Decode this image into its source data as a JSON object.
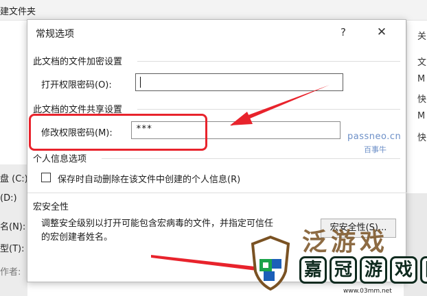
{
  "background": {
    "window_title": "建文件夹",
    "left_rows": [
      "盘 (C:)",
      "(D:)",
      "名(N):",
      "型(T):",
      "作者:"
    ],
    "right_items": [
      "关",
      "文",
      "M",
      "快",
      "M",
      "快"
    ]
  },
  "dialog": {
    "title": "常规选项",
    "help_label": "?",
    "close_label": "✕",
    "encryption": {
      "section_title": "此文档的文件加密设置",
      "open_label": "打开权限密码(O):",
      "open_value": ""
    },
    "sharing": {
      "section_title": "此文档的文件共享设置",
      "modify_label": "修改权限密码(M):",
      "modify_value": "***"
    },
    "privacy": {
      "section_title": "个人信息选项",
      "checkbox_label": "保存时自动删除在该文件中创建的个人信息(R)",
      "checked": false
    },
    "macro": {
      "section_title": "宏安全性",
      "description_line1": "调整安全级别以打开可能包含宏病毒的文件，并指定可信任",
      "description_line2": "的宏创建者姓名。",
      "button_label": "宏安全性(S)..."
    }
  },
  "watermark": {
    "site": "passneo.cn",
    "brand": "百事牛"
  },
  "logo": {
    "top_chars": "泛游戏",
    "chars": [
      "嘉",
      "冠",
      "游",
      "戏",
      "网"
    ],
    "url": "www.03mm.net"
  },
  "colors": {
    "annotation_red": "#e8232c",
    "watermark_blue": "#6c8fc7",
    "logo_green": "#1aa34a",
    "logo_blue": "#1c5fb8"
  },
  "icons": [
    "question-icon",
    "close-icon",
    "checkbox-icon",
    "arrow-annotation-icon",
    "shield-logo-icon"
  ]
}
